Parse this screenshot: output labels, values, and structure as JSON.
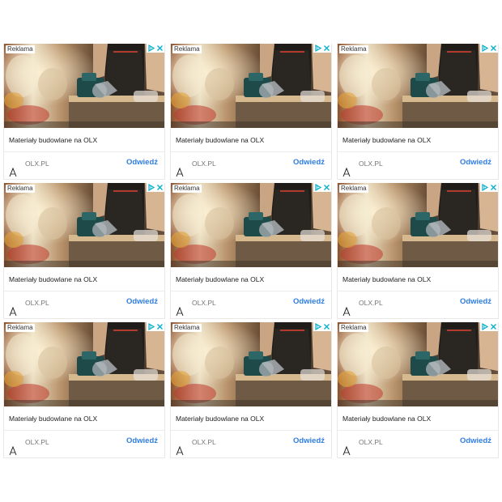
{
  "ad": {
    "label": "Reklama",
    "title": "Materiały budowlane na OLX",
    "domain": "OLX.PL",
    "cta": "Odwiedź",
    "icons": {
      "info": "adchoices-info-icon",
      "close": "close-icon",
      "logo": "advertiser-logo-icon"
    }
  },
  "grid": {
    "rows": 3,
    "columns": 3
  },
  "colors": {
    "cta": "#2f7de1",
    "adchoices": "#00aecd",
    "text": "#222222",
    "domain": "#757575"
  }
}
